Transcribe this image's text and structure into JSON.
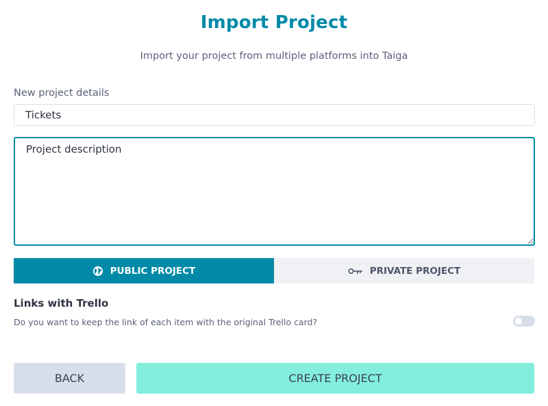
{
  "header": {
    "title": "Import Project",
    "subtitle": "Import your project from multiple platforms into Taiga"
  },
  "form": {
    "section_label": "New project details",
    "name_value": "Tickets",
    "description_placeholder": "Project description",
    "description_value": ""
  },
  "privacy": {
    "public_label": "PUBLIC PROJECT",
    "public_icon": "globe-icon",
    "private_label": "PRIVATE PROJECT",
    "private_icon": "key-icon",
    "selected": "public"
  },
  "trello": {
    "title": "Links with Trello",
    "description": "Do you want to keep the link of each item with the original Trello card?",
    "keep_links": false
  },
  "actions": {
    "back_label": "BACK",
    "create_label": "CREATE PROJECT"
  },
  "colors": {
    "accent": "#008aa8",
    "create_button": "#83eedc",
    "back_button": "#d8dee9"
  }
}
